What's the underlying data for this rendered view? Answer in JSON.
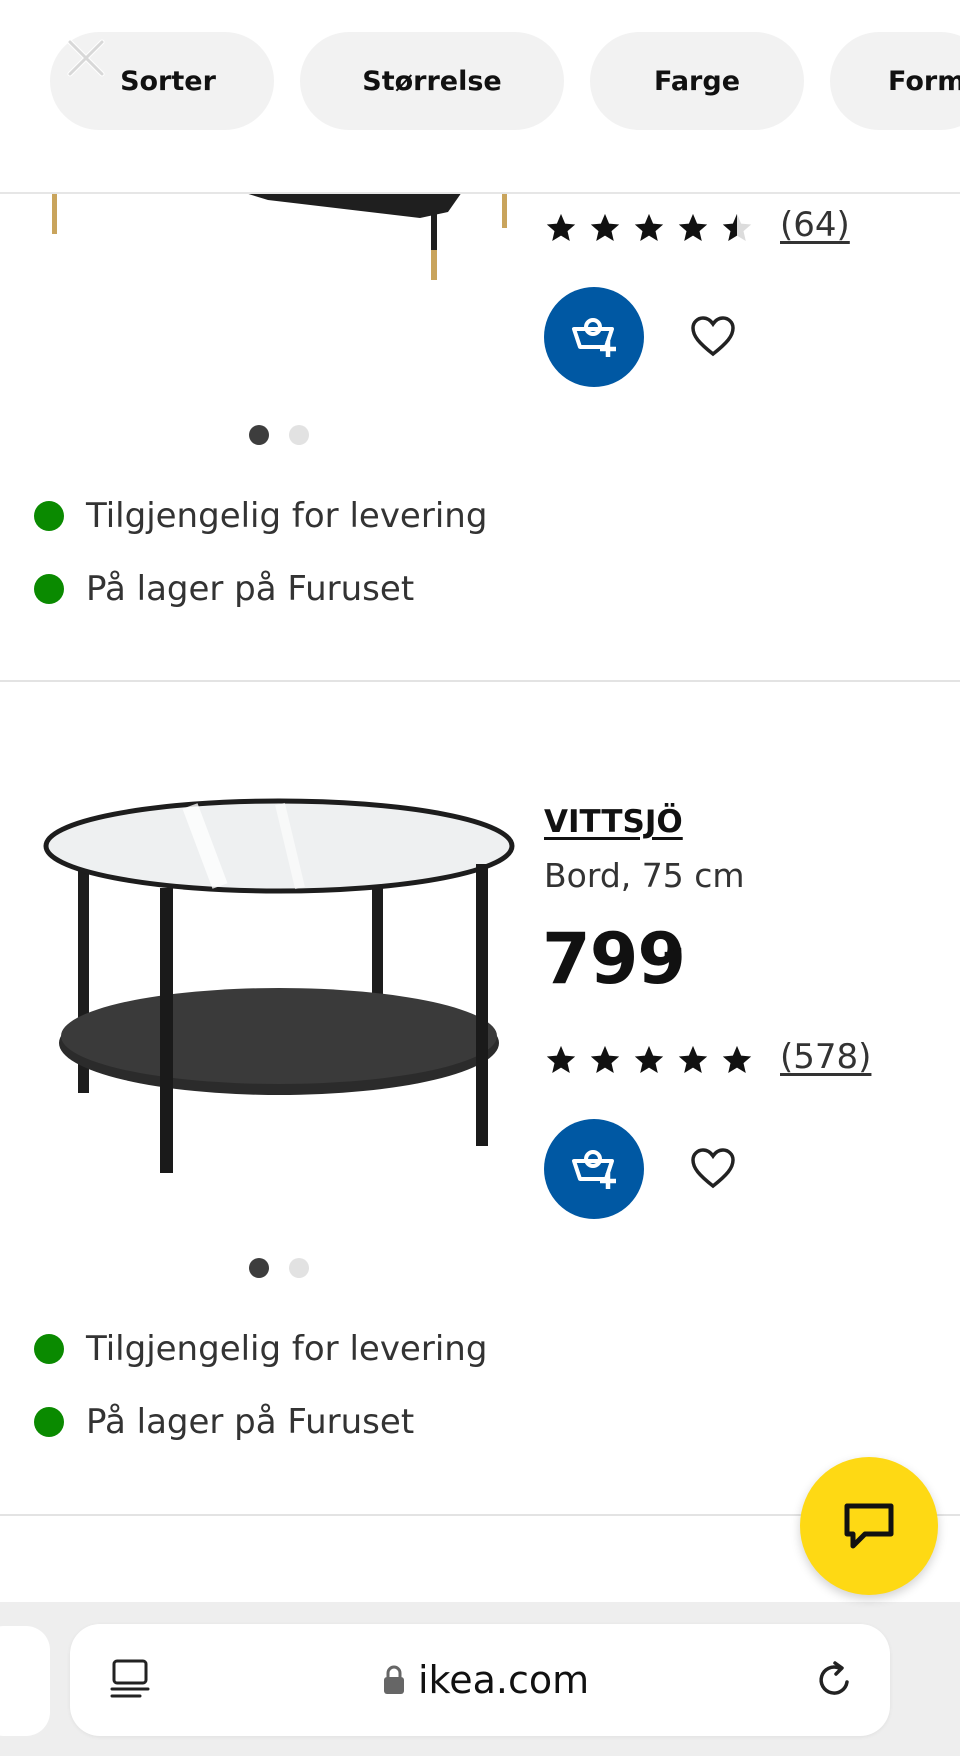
{
  "filters": [
    {
      "label": "Sorter"
    },
    {
      "label": "Størrelse"
    },
    {
      "label": "Farge"
    },
    {
      "label": "Form"
    }
  ],
  "icons": {
    "close": "close-icon",
    "cart": "add-to-cart-icon",
    "wishlist": "heart-icon",
    "chat": "chat-icon",
    "lock": "lock-icon",
    "reader": "reader-mode-icon",
    "reload": "reload-icon"
  },
  "products": [
    {
      "rating": 4.5,
      "review_count": "(64)",
      "image_slide": "1 of 2",
      "availability": [
        {
          "text": "Tilgjengelig for levering",
          "status": "available"
        },
        {
          "text": "På lager på Furuset",
          "status": "available"
        }
      ]
    },
    {
      "name": "VITTSJÖ",
      "description": "Bord, 75 cm",
      "price": "799",
      "price_suffix": ",-",
      "rating": 5,
      "review_count": "(578)",
      "image_slide": "1 of 2",
      "availability": [
        {
          "text": "Tilgjengelig for levering",
          "status": "available"
        },
        {
          "text": "På lager på Furuset",
          "status": "available"
        }
      ]
    }
  ],
  "browser": {
    "url": "ikea.com"
  },
  "colors": {
    "cart_button": "#0058a3",
    "chat_button": "#fed914",
    "available_dot": "#0a8a00",
    "chip_bg": "#f2f2f2"
  }
}
